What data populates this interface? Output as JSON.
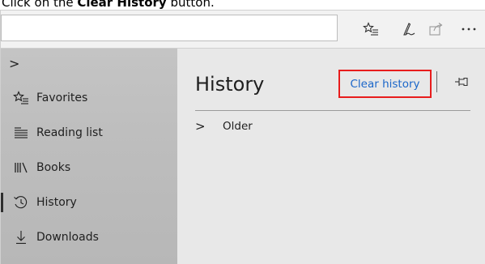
{
  "instruction": {
    "prefix": "Click on the ",
    "target": "Clear History",
    "suffix": " button."
  },
  "toolbar": {
    "icons": [
      "favorites-star-icon",
      "pen-notes-icon",
      "share-icon",
      "more-icon"
    ]
  },
  "hub": {
    "expand_glyph": ">",
    "items": [
      {
        "label": "Favorites",
        "icon": "star-list-icon"
      },
      {
        "label": "Reading list",
        "icon": "reading-list-icon"
      },
      {
        "label": "Books",
        "icon": "books-icon"
      },
      {
        "label": "History",
        "icon": "history-clock-icon",
        "active": true
      },
      {
        "label": "Downloads",
        "icon": "download-arrow-icon"
      }
    ]
  },
  "history_pane": {
    "title": "History",
    "clear_button_label": "Clear history",
    "sections": [
      {
        "label": "Older",
        "expanded": false
      }
    ]
  },
  "colors": {
    "link_blue": "#1a66c9",
    "highlight_red": "#e81c1c",
    "pane_bg": "#e8e8e8",
    "hub_bg": "#bdbdbd"
  }
}
